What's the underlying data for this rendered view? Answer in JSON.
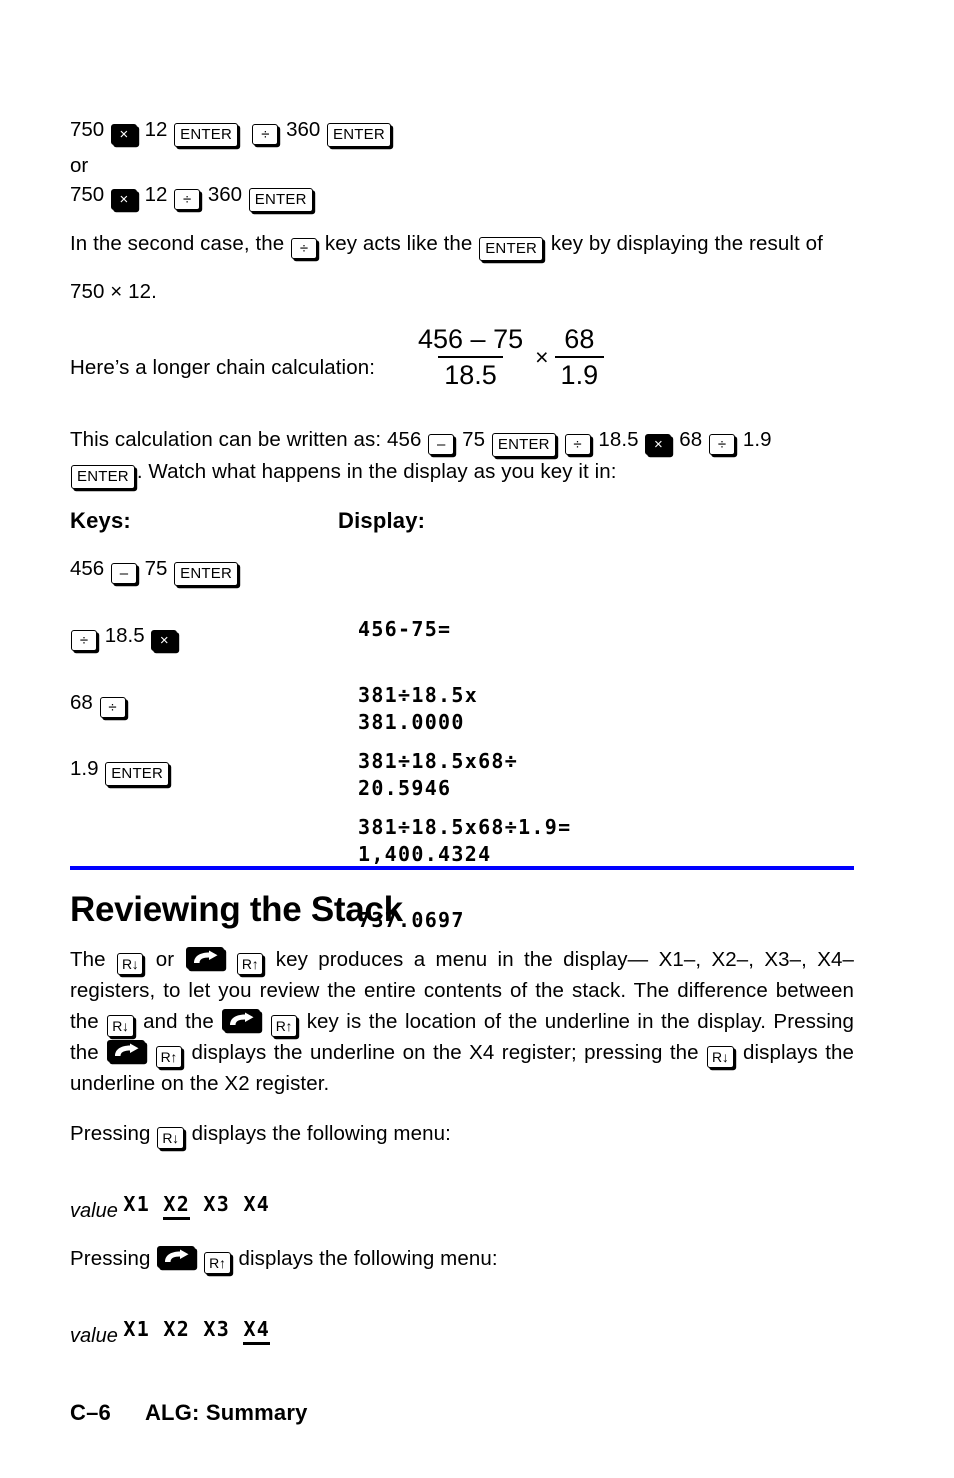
{
  "page": {
    "footer_page": "C–6",
    "footer_title": "ALG: Summary",
    "accent_rule_color": "#0000ff"
  },
  "intro": {
    "seq1_a": "750",
    "seq1_b": "12",
    "seq1_c": "360",
    "or_label": "or",
    "seq2_a": "750",
    "seq2_b": "12",
    "seq2_c": "360",
    "para_second_case_1": "In the second case, the",
    "para_second_case_2": "key acts like the",
    "para_second_case_3": "key by displaying the result of",
    "para_second_case_4": "750 × 12.",
    "chain_lead": "Here’s a longer chain calculation:"
  },
  "formula": {
    "numerator1": "456 – 75",
    "denominator1": "18.5",
    "operator": "×",
    "numerator2": "68",
    "denominator2": "1.9"
  },
  "written_as": {
    "lead": "This calculation can be written as:",
    "v1": "456",
    "v2": "75",
    "v3": "18.5",
    "v4": "68",
    "v5": "1.9",
    "tail": ". Watch what happens in the display as you key it in:"
  },
  "table": {
    "col_keys": "Keys:",
    "col_display": "Display:",
    "rows": [
      {
        "keys_pre": "456",
        "keys_mid": "75",
        "keys_post": "",
        "display_line1": "456-75=",
        "display_line2": "381.0000"
      },
      {
        "keys_pre": "",
        "keys_mid": "18.5",
        "keys_post": "",
        "display_line1": "381÷18.5x",
        "display_line2": "20.5946"
      },
      {
        "keys_pre": "68",
        "keys_mid": "",
        "keys_post": "",
        "display_line1": "381÷18.5x68÷",
        "display_line2": "1,400.4324"
      },
      {
        "keys_pre": "1.9",
        "keys_mid": "",
        "keys_post": "",
        "display_line1": "381÷18.5x68÷1.9=",
        "display_line2": "737.0697"
      }
    ]
  },
  "section": {
    "title": "Reviewing the Stack",
    "p1_a": "The",
    "p1_b": "or",
    "p1_c": "key produces a menu in the display— X1–, X2–, X3–, X4–registers, to let you review the entire contents of the stack. The difference between the",
    "p1_d": "and the",
    "p1_e": "key is the location of the underline in the display. Pressing the",
    "p1_f": "displays the underline on the X4 register; pressing the",
    "p1_g": "displays the underline on the X2 register.",
    "p2_a": "Pressing",
    "p2_b": "displays the following menu:",
    "menu1_prefix": "X1 ",
    "menu1_underlined": "X2",
    "menu1_suffix": " X3 X4",
    "menu1_value": "value",
    "p3_a": "Pressing",
    "p3_b": "displays the following menu:",
    "menu2_prefix": "X1 X2 X3 ",
    "menu2_underlined": "X4",
    "menu2_suffix": "",
    "menu2_value": "value"
  },
  "icons": {
    "multiply": "×",
    "divide": "÷",
    "minus": "–",
    "enter": "ENTER",
    "roll_down": "R↓",
    "roll_up": "R↑",
    "shift": "shift-arrow"
  }
}
